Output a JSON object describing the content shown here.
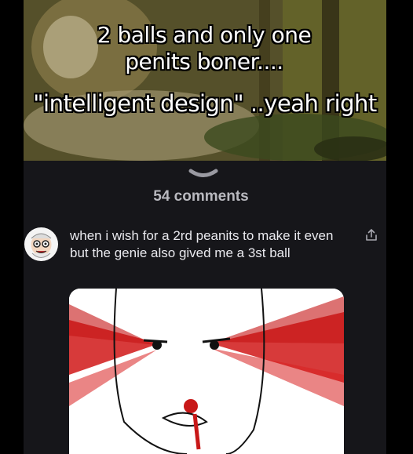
{
  "post": {
    "meme_caption_line1": "2 balls and only one",
    "meme_caption_line2": "penits boner....",
    "meme_caption_line3": "\"intelligent design\" ..yeah right"
  },
  "comments": {
    "count_label": "54 comments"
  },
  "comment": {
    "text": "when i wish for a 2rd peanits to make it even but the genie also gived me a 3st ball"
  },
  "icons": {
    "collapse": "chevron-down-icon",
    "share": "share-icon"
  },
  "colors": {
    "background": "#000000",
    "panel": "#16161a",
    "comment_text": "#e9e9ee",
    "comments_count": "#b9b9bf",
    "laser_red": "#d01818"
  }
}
